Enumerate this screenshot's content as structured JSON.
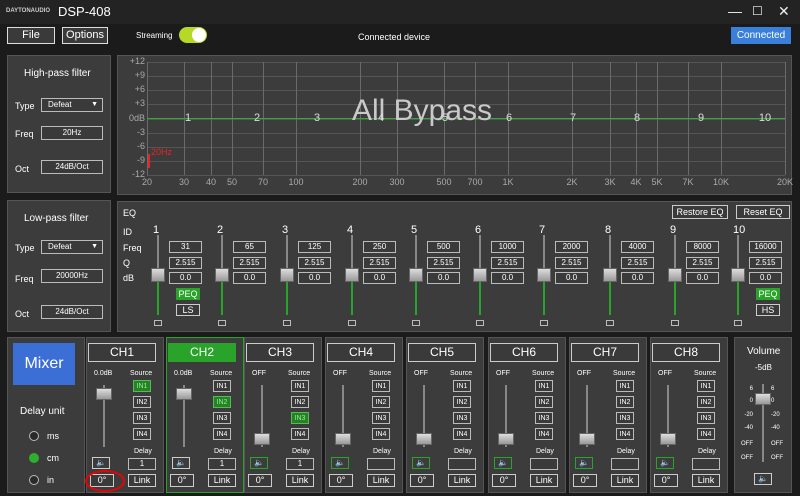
{
  "app": {
    "logo": "DAYTONAUDIO",
    "title": "DSP-408",
    "minimize": "—",
    "maximize": "☐",
    "close": "✕"
  },
  "toolbar": {
    "file": "File",
    "options": "Options",
    "streaming": "Streaming",
    "status": "Connected device",
    "connected": "Connected"
  },
  "highpass": {
    "title": "High-pass filter",
    "type_label": "Type",
    "type_value": "Defeat",
    "freq_label": "Freq",
    "freq_value": "20Hz",
    "oct_label": "Oct",
    "oct_value": "24dB/Oct"
  },
  "lowpass": {
    "title": "Low-pass filter",
    "type_label": "Type",
    "type_value": "Defeat",
    "freq_label": "Freq",
    "freq_value": "20000Hz",
    "oct_label": "Oct",
    "oct_value": "24dB/Oct"
  },
  "graph": {
    "overlay": "All Bypass",
    "marker": "20Hz",
    "ylabels": [
      "+12",
      "+9",
      "+6",
      "+3",
      "0dB",
      "-3",
      "-6",
      "-9",
      "-12"
    ],
    "xlabels": [
      "20",
      "30",
      "40",
      "50",
      "70",
      "100",
      "200",
      "300",
      "500",
      "700",
      "1K",
      "2K",
      "3K",
      "4K",
      "5K",
      "7K",
      "10K",
      "20K"
    ],
    "bandnums": [
      "1",
      "2",
      "3",
      "4",
      "5",
      "6",
      "7",
      "8",
      "9",
      "10"
    ]
  },
  "eq": {
    "title": "EQ",
    "restore": "Restore EQ",
    "reset": "Reset EQ",
    "row_id": "ID",
    "row_freq": "Freq",
    "row_q": "Q",
    "row_db": "dB",
    "bands": [
      {
        "id": "1",
        "freq": "31",
        "q": "2.515",
        "db": "0.0",
        "mode": "PEQ",
        "alt": "LS"
      },
      {
        "id": "2",
        "freq": "65",
        "q": "2.515",
        "db": "0.0"
      },
      {
        "id": "3",
        "freq": "125",
        "q": "2.515",
        "db": "0.0"
      },
      {
        "id": "4",
        "freq": "250",
        "q": "2.515",
        "db": "0.0"
      },
      {
        "id": "5",
        "freq": "500",
        "q": "2.515",
        "db": "0.0"
      },
      {
        "id": "6",
        "freq": "1000",
        "q": "2.515",
        "db": "0.0"
      },
      {
        "id": "7",
        "freq": "2000",
        "q": "2.515",
        "db": "0.0"
      },
      {
        "id": "8",
        "freq": "4000",
        "q": "2.515",
        "db": "0.0"
      },
      {
        "id": "9",
        "freq": "8000",
        "q": "2.515",
        "db": "0.0"
      },
      {
        "id": "10",
        "freq": "16000",
        "q": "2.515",
        "db": "0.0",
        "mode": "PEQ",
        "alt": "HS"
      }
    ]
  },
  "mixer": {
    "label": "Mixer",
    "delay_unit": "Delay unit",
    "units": [
      "ms",
      "cm",
      "in"
    ],
    "selected_unit": "cm",
    "source_label": "Source",
    "delay_label": "Delay",
    "link": "Link",
    "inputs": [
      "IN1",
      "IN2",
      "IN3",
      "IN4"
    ],
    "channels": [
      {
        "name": "CH1",
        "level": "0.0dB",
        "src": 0,
        "delay": "1",
        "phase": "0°",
        "active": true,
        "selected": false
      },
      {
        "name": "CH2",
        "level": "0.0dB",
        "src": 1,
        "delay": "1",
        "phase": "0°",
        "active": true,
        "selected": true
      },
      {
        "name": "CH3",
        "level": "OFF",
        "src": 2,
        "delay": "1",
        "phase": "0°",
        "active": false,
        "selected": false
      },
      {
        "name": "CH4",
        "level": "OFF",
        "src": -1,
        "delay": "",
        "phase": "0°",
        "active": false,
        "selected": false
      },
      {
        "name": "CH5",
        "level": "OFF",
        "src": -1,
        "delay": "",
        "phase": "0°",
        "active": false,
        "selected": false
      },
      {
        "name": "CH6",
        "level": "OFF",
        "src": -1,
        "delay": "",
        "phase": "0°",
        "active": false,
        "selected": false
      },
      {
        "name": "CH7",
        "level": "OFF",
        "src": -1,
        "delay": "",
        "phase": "0°",
        "active": false,
        "selected": false
      },
      {
        "name": "CH8",
        "level": "OFF",
        "src": -1,
        "delay": "",
        "phase": "0°",
        "active": false,
        "selected": false
      }
    ]
  },
  "volume": {
    "title": "Volume",
    "value": "-5dB",
    "scale": [
      "6",
      "0",
      "-20",
      "-40",
      "OFF",
      "OFF"
    ]
  },
  "colors": {
    "accent_blue": "#3a7fd9",
    "green": "#29a329",
    "mixer_blue": "#3b6fd6"
  }
}
